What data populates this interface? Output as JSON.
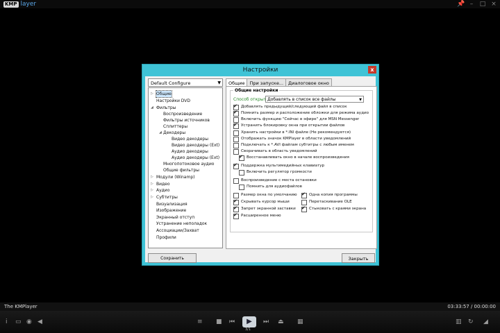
{
  "app": {
    "logo_box": "KMP",
    "logo_text": "layer"
  },
  "window_buttons": {
    "pin": "📌",
    "minimize": "–",
    "maximize": "□",
    "close": "×"
  },
  "dialog": {
    "title": "Настройки",
    "close": "x",
    "config_select": "Default Configure",
    "tree": [
      "Общие",
      "Настройки DVD",
      "Фильтры",
      "Воспроизведение",
      "Фильтры источников",
      "Сплиттеры",
      "Декодеры",
      "Видео декодеры",
      "Видео декодеры (Ext)",
      "Аудио декодеры",
      "Аудио декодеры (Ext)",
      "Многопотоковое аудио",
      "Общие фильтры",
      "Модули (Winamp)",
      "Видео",
      "Аудио",
      "Субтитры",
      "Визуализация",
      "Изображение",
      "Экранный отступ",
      "Устранение неполадок",
      "Ассоциации/Захват",
      "Профили"
    ],
    "tabs": [
      "Общие",
      "При запуске...",
      "Диалоговое окно"
    ],
    "group_title": "Общие настройки",
    "open_label": "Способ открытия",
    "open_value": "Добавлять в список все файлы",
    "checkboxes": [
      {
        "label": "Добавлять предыдущий/следующий файл в список",
        "checked": true
      },
      {
        "label": "Помнить размер и расположение обложки для режима аудио",
        "checked": true
      },
      {
        "label": "Включить функцию \"Сейчас в эфире\" для MSN Messenger",
        "checked": false
      },
      {
        "label": "Устранить блокировку окна при открытии файлов",
        "checked": true
      },
      {
        "label": "Хранить настройки в *.INI файле (Не рекомендуется)",
        "checked": false
      },
      {
        "label": "Отображать значок KMPlayer в области уведомлений",
        "checked": false
      },
      {
        "label": "Подключать к *.AVI файлам субтитры с любым именем",
        "checked": false
      },
      {
        "label": "Сворачивать в область уведомлений",
        "checked": false
      },
      {
        "label": "Восстанавливать окно в начале воспроизведения",
        "checked": true
      },
      {
        "label": "Поддержка мультимедийных клавиатур",
        "checked": true
      },
      {
        "label": "Включить регулятор громкости",
        "checked": false
      },
      {
        "label": "Воспроизведение с места остановки",
        "checked": false
      },
      {
        "label": "Помнить для аудиофайлов",
        "checked": false
      },
      {
        "label": "Размер окна по умолчанию",
        "checked": false
      },
      {
        "label": "Скрывать курсор мыши",
        "checked": true
      },
      {
        "label": "Запрет экранной заставки",
        "checked": true
      },
      {
        "label": "Расширенное меню",
        "checked": true
      },
      {
        "label": "Одна копия программы",
        "checked": true
      },
      {
        "label": "Перетаскивание OLE",
        "checked": false
      },
      {
        "label": "Стыковать с краями экрана",
        "checked": true
      }
    ],
    "save_button": "Сохранить настройки...",
    "close_button": "Закрыть"
  },
  "status": {
    "title": "The KMPlayer",
    "time": "03:33:57 / 00:00:00"
  },
  "controls": {
    "info": "i",
    "subtitle": "▭",
    "capture": "◉",
    "volume": "◀",
    "playlist": "≡",
    "stop": "■",
    "prev": "⏮",
    "play": "▶",
    "next": "⏭",
    "eject": "⏏",
    "settings": "▦",
    "tracknum": "3/1",
    "pref": "▥",
    "repeat": "↻",
    "vol_right": "◢"
  },
  "colors": {
    "dialog_frame": "#3fc3d6",
    "close_red": "#c8392b",
    "accent_green": "#2a8a2a"
  }
}
